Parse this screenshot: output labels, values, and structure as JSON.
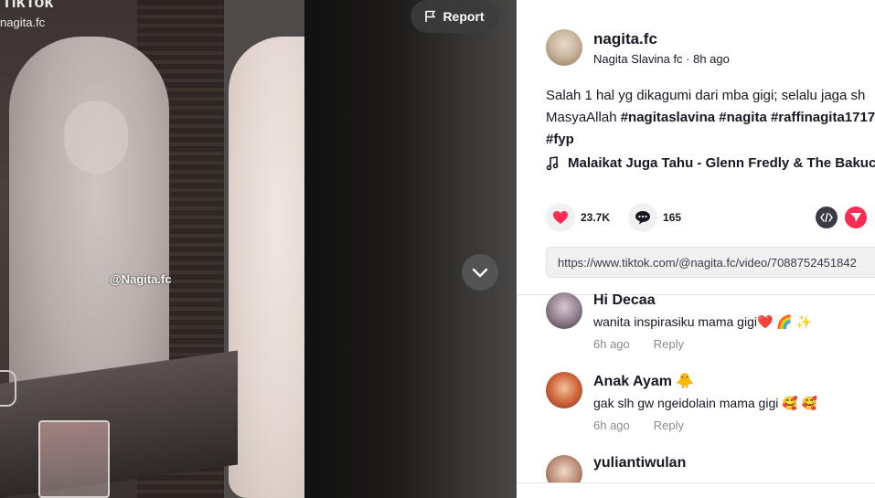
{
  "video": {
    "watermark_brand": "TikTok",
    "watermark_handle": "nagita.fc",
    "overlay_label": "@Nagita.fc",
    "report_label": "Report"
  },
  "author": {
    "username": "nagita.fc",
    "subline": "Nagita Slavina fc · 8h ago"
  },
  "caption": {
    "line1": "Salah 1 hal yg dikagumi dari mba gigi; selalu jaga sh",
    "line2_text": "MasyaAllah ",
    "hashtags_line2": [
      "#nagitaslavina",
      "#nagita",
      "#raffinagita1717"
    ],
    "hashtags_line3": [
      "#fyp"
    ]
  },
  "music": {
    "title": "Malaikat Juga Tahu - Glenn Fredly & The Bakuc"
  },
  "actions": {
    "likes": "23.7K",
    "comments": "165"
  },
  "link": {
    "url": "https://www.tiktok.com/@nagita.fc/video/7088752451842"
  },
  "comments": [
    {
      "name": "Hi Decaa",
      "text": "wanita inspirasiku mama gigi❤️ 🌈 ✨",
      "time": "6h ago",
      "reply": "Reply"
    },
    {
      "name": "Anak Ayam 🐥",
      "text": "gak slh gw ngeidolain mama gigi 🥰 🥰",
      "time": "6h ago",
      "reply": "Reply"
    },
    {
      "name": "yuliantiwulan",
      "text": "",
      "time": "",
      "reply": ""
    }
  ],
  "colors": {
    "brand_red": "#fe2c55",
    "text": "#161823",
    "muted": "#8a8b91",
    "surface": "#f1f1f2"
  }
}
